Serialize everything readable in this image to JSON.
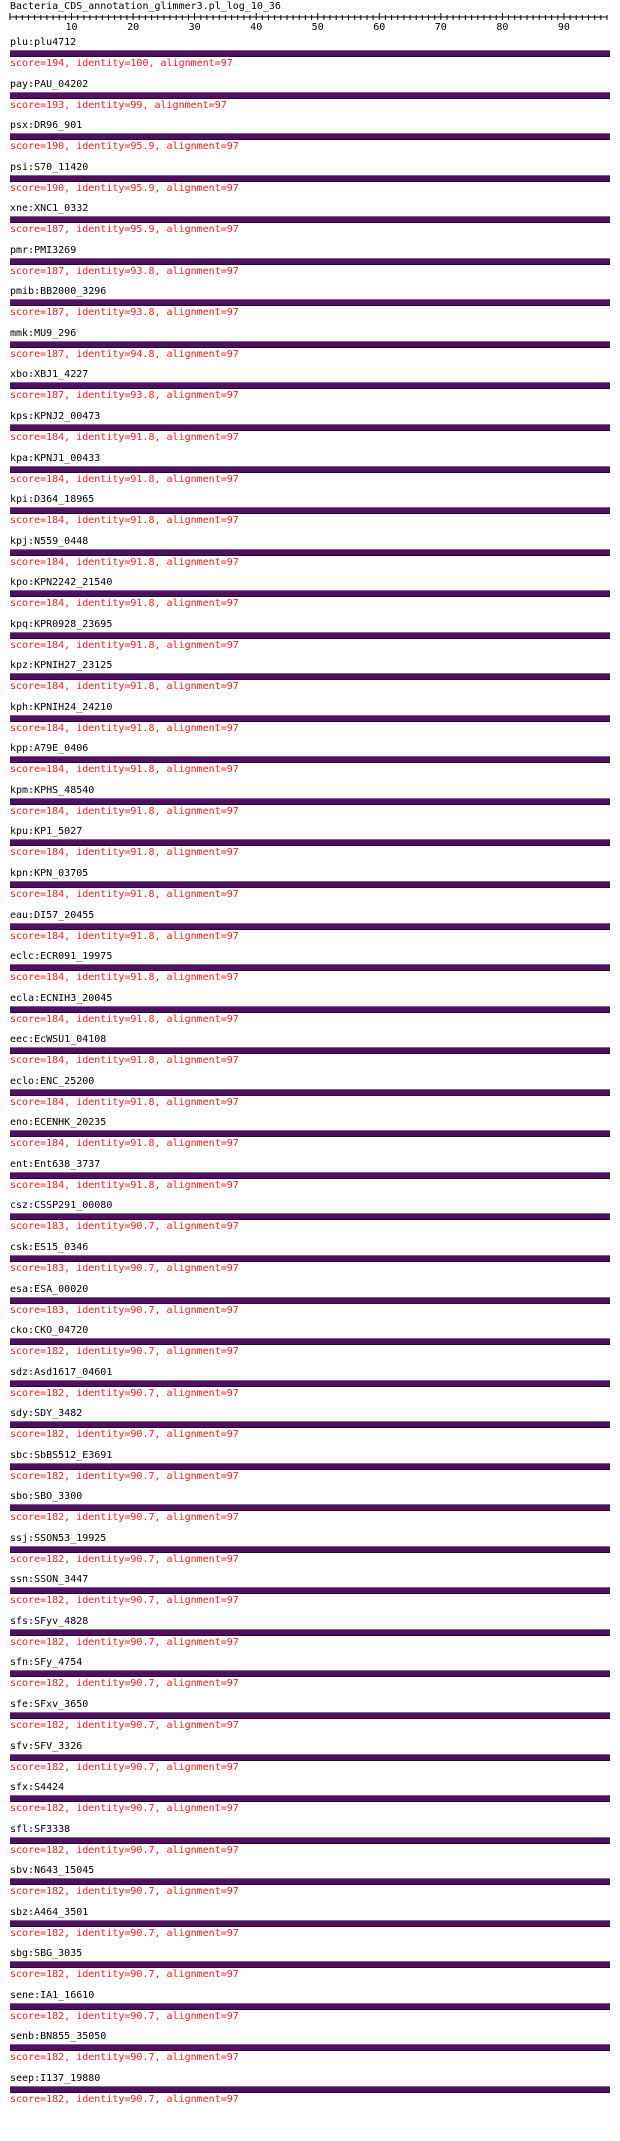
{
  "header": {
    "title": "Bacteria_CDS_annotation_glimmer3.pl_log_10_36"
  },
  "ruler": {
    "ticks": [
      "10",
      "20",
      "30",
      "40",
      "50",
      "60",
      "70",
      "80",
      "90"
    ],
    "max": 97
  },
  "colors": {
    "bar": "#501060",
    "score_text": "#ff1a1a",
    "label_text": "#000000"
  },
  "hits": [
    {
      "name": "plu:plu4712",
      "score": "score=194, identity=100, alignment=97"
    },
    {
      "name": "pay:PAU_04202",
      "score": "score=193, identity=99, alignment=97"
    },
    {
      "name": "psx:DR96_901",
      "score": "score=190, identity=95.9, alignment=97"
    },
    {
      "name": "psi:S70_11420",
      "score": "score=190, identity=95.9, alignment=97"
    },
    {
      "name": "xne:XNC1_0332",
      "score": "score=187, identity=95.9, alignment=97"
    },
    {
      "name": "pmr:PMI3269",
      "score": "score=187, identity=93.8, alignment=97"
    },
    {
      "name": "pmib:BB2000_3296",
      "score": "score=187, identity=93.8, alignment=97"
    },
    {
      "name": "mmk:MU9_296",
      "score": "score=187, identity=94.8, alignment=97"
    },
    {
      "name": "xbo:XBJ1_4227",
      "score": "score=187, identity=93.8, alignment=97"
    },
    {
      "name": "kps:KPNJ2_00473",
      "score": "score=184, identity=91.8, alignment=97"
    },
    {
      "name": "kpa:KPNJ1_00433",
      "score": "score=184, identity=91.8, alignment=97"
    },
    {
      "name": "kpi:D364_18965",
      "score": "score=184, identity=91.8, alignment=97"
    },
    {
      "name": "kpj:N559_0448",
      "score": "score=184, identity=91.8, alignment=97"
    },
    {
      "name": "kpo:KPN2242_21540",
      "score": "score=184, identity=91.8, alignment=97"
    },
    {
      "name": "kpq:KPR0928_23695",
      "score": "score=184, identity=91.8, alignment=97"
    },
    {
      "name": "kpz:KPNIH27_23125",
      "score": "score=184, identity=91.8, alignment=97"
    },
    {
      "name": "kph:KPNIH24_24210",
      "score": "score=184, identity=91.8, alignment=97"
    },
    {
      "name": "kpp:A79E_0406",
      "score": "score=184, identity=91.8, alignment=97"
    },
    {
      "name": "kpm:KPHS_48540",
      "score": "score=184, identity=91.8, alignment=97"
    },
    {
      "name": "kpu:KP1_5027",
      "score": "score=184, identity=91.8, alignment=97"
    },
    {
      "name": "kpn:KPN_03705",
      "score": "score=184, identity=91.8, alignment=97"
    },
    {
      "name": "eau:DI57_20455",
      "score": "score=184, identity=91.8, alignment=97"
    },
    {
      "name": "eclc:ECR091_19975",
      "score": "score=184, identity=91.8, alignment=97"
    },
    {
      "name": "ecla:ECNIH3_20045",
      "score": "score=184, identity=91.8, alignment=97"
    },
    {
      "name": "eec:EcWSU1_04108",
      "score": "score=184, identity=91.8, alignment=97"
    },
    {
      "name": "eclo:ENC_25200",
      "score": "score=184, identity=91.8, alignment=97"
    },
    {
      "name": "eno:ECENHK_20235",
      "score": "score=184, identity=91.8, alignment=97"
    },
    {
      "name": "ent:Ent638_3737",
      "score": "score=184, identity=91.8, alignment=97"
    },
    {
      "name": "csz:CSSP291_00080",
      "score": "score=183, identity=90.7, alignment=97"
    },
    {
      "name": "csk:ES15_0346",
      "score": "score=183, identity=90.7, alignment=97"
    },
    {
      "name": "esa:ESA_00020",
      "score": "score=183, identity=90.7, alignment=97"
    },
    {
      "name": "cko:CKO_04720",
      "score": "score=182, identity=90.7, alignment=97"
    },
    {
      "name": "sdz:Asd1617_04601",
      "score": "score=182, identity=90.7, alignment=97"
    },
    {
      "name": "sdy:SDY_3482",
      "score": "score=182, identity=90.7, alignment=97"
    },
    {
      "name": "sbc:SbBS512_E3691",
      "score": "score=182, identity=90.7, alignment=97"
    },
    {
      "name": "sbo:SBO_3300",
      "score": "score=182, identity=90.7, alignment=97"
    },
    {
      "name": "ssj:SSON53_19925",
      "score": "score=182, identity=90.7, alignment=97"
    },
    {
      "name": "ssn:SSON_3447",
      "score": "score=182, identity=90.7, alignment=97"
    },
    {
      "name": "sfs:SFyv_4828",
      "score": "score=182, identity=90.7, alignment=97"
    },
    {
      "name": "sfn:SFy_4754",
      "score": "score=182, identity=90.7, alignment=97"
    },
    {
      "name": "sfe:SFxv_3650",
      "score": "score=182, identity=90.7, alignment=97"
    },
    {
      "name": "sfv:SFV_3326",
      "score": "score=182, identity=90.7, alignment=97"
    },
    {
      "name": "sfx:S4424",
      "score": "score=182, identity=90.7, alignment=97"
    },
    {
      "name": "sfl:SF3338",
      "score": "score=182, identity=90.7, alignment=97"
    },
    {
      "name": "sbv:N643_15045",
      "score": "score=182, identity=90.7, alignment=97"
    },
    {
      "name": "sbz:A464_3501",
      "score": "score=182, identity=90.7, alignment=97"
    },
    {
      "name": "sbg:SBG_3035",
      "score": "score=182, identity=90.7, alignment=97"
    },
    {
      "name": "sene:IA1_16610",
      "score": "score=182, identity=90.7, alignment=97"
    },
    {
      "name": "senb:BN855_35050",
      "score": "score=182, identity=90.7, alignment=97"
    },
    {
      "name": "seep:I137_19880",
      "score": "score=182, identity=90.7, alignment=97"
    }
  ]
}
